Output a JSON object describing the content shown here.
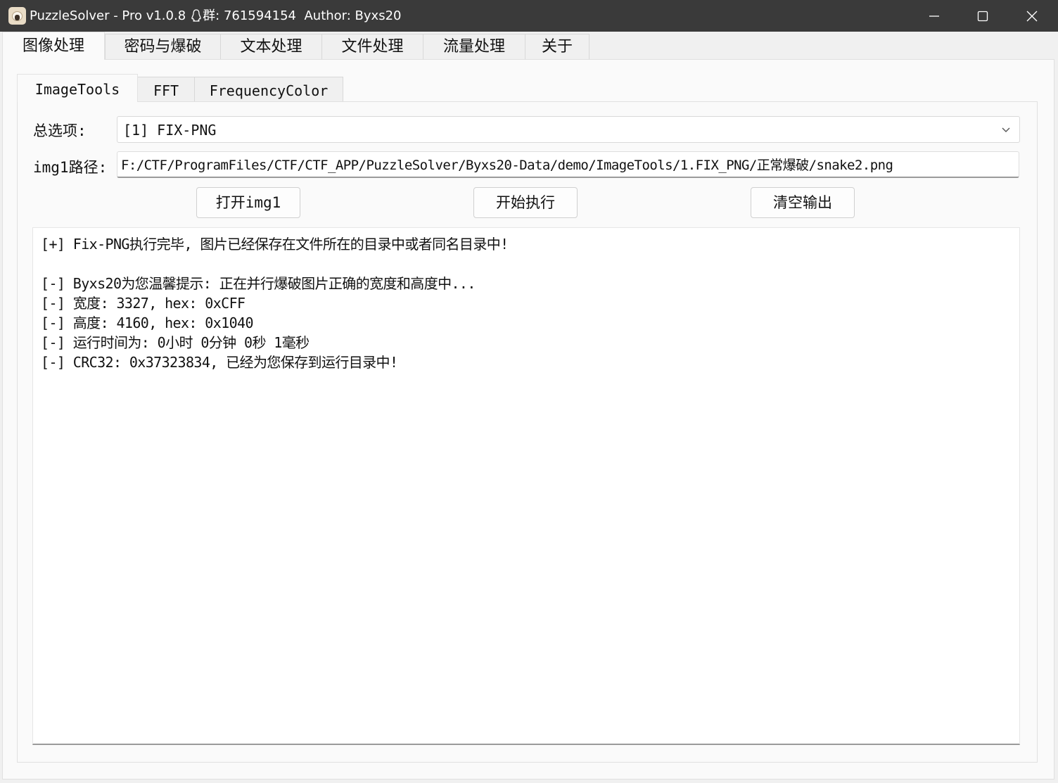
{
  "window": {
    "title_app": "PuzzleSolver - Pro v1.0.8",
    "title_group": "群: 761594154",
    "title_author": "Author:  Byxs20"
  },
  "icons": {
    "app": "sheep-icon",
    "qq": "penguin-icon",
    "minimize": "minimize-icon",
    "maximize": "maximize-icon",
    "close": "close-icon",
    "dropdown": "chevron-down-icon"
  },
  "top_tabs": [
    "图像处理",
    "密码与爆破",
    "文本处理",
    "文件处理",
    "流量处理",
    "关于"
  ],
  "active_top_tab": "图像处理",
  "sub_tabs": [
    "ImageTools",
    "FFT",
    "FrequencyColor"
  ],
  "active_sub_tab": "ImageTools",
  "form": {
    "option_label": "总选项:",
    "option_value": "[1] FIX-PNG",
    "path_label": "img1路径:",
    "path_value": "F:/CTF/ProgramFiles/CTF/CTF_APP/PuzzleSolver/Byxs20-Data/demo/ImageTools/1.FIX_PNG/正常爆破/snake2.png"
  },
  "buttons": {
    "open": "打开img1",
    "run": "开始执行",
    "clear": "清空输出"
  },
  "output_lines": [
    "[+] Fix-PNG执行完毕, 图片已经保存在文件所在的目录中或者同名目录中!",
    "",
    "[-] Byxs20为您温馨提示: 正在并行爆破图片正确的宽度和高度中...",
    "[-] 宽度: 3327, hex: 0xCFF",
    "[-] 高度: 4160, hex: 0x1040",
    "[-] 运行时间为: 0小时 0分钟 0秒 1毫秒",
    "[-] CRC32: 0x37323834, 已经为您保存到运行目录中!"
  ],
  "colors": {
    "titlebar": "#3a3a3a",
    "background": "#f0f0f0",
    "panel": "#fafafa"
  }
}
